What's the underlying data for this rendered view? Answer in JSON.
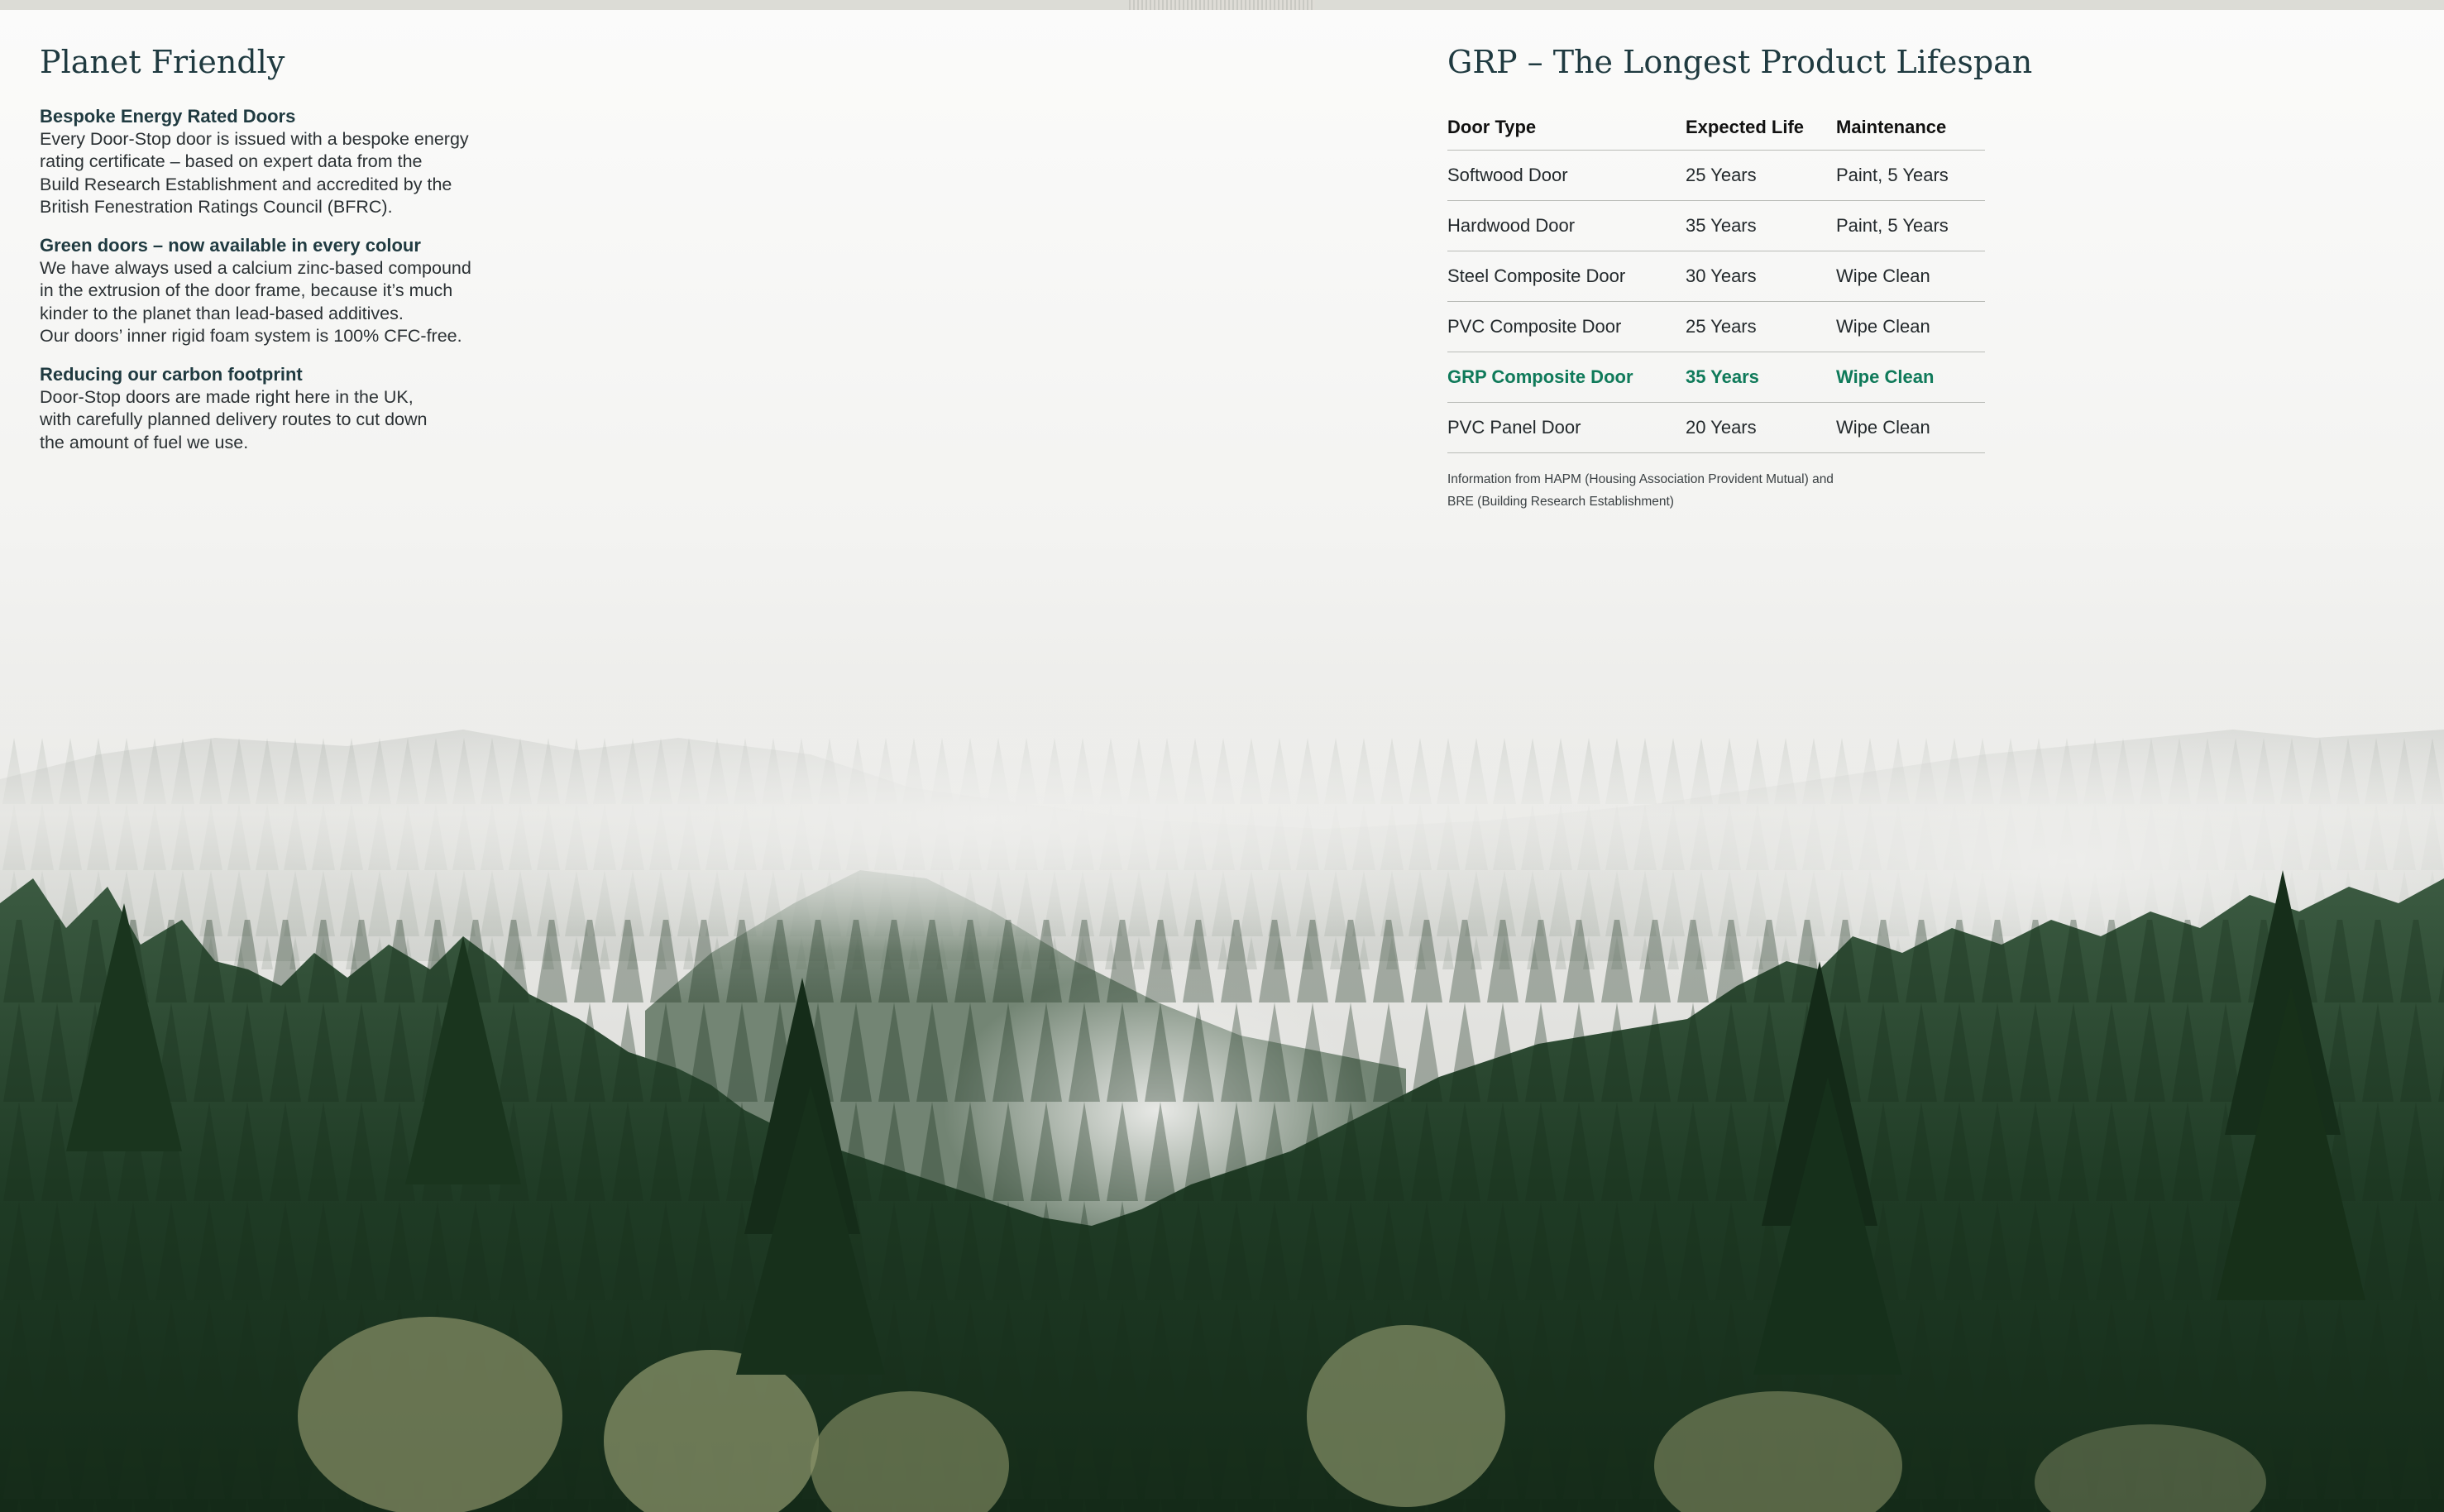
{
  "planet": {
    "title": "Planet Friendly",
    "sections": [
      {
        "heading": "Bespoke Energy Rated Doors",
        "body": "Every Door-Stop door is issued with a bespoke energy\nrating certificate – based on expert data from the\nBuild Research Establishment and accredited by the\nBritish Fenestration Ratings Council (BFRC)."
      },
      {
        "heading": "Green doors – now available in every colour",
        "body": "We have always used a calcium zinc-based compound\nin the extrusion of the door frame, because it’s much\nkinder to the planet than lead-based additives.\nOur doors’ inner rigid foam system is 100% CFC-free."
      },
      {
        "heading": "Reducing our carbon footprint",
        "body": "Door-Stop doors are made right here in the UK,\nwith carefully planned delivery routes to cut down\nthe amount of fuel we use."
      }
    ]
  },
  "lifespan": {
    "title": "GRP – The Longest Product Lifespan",
    "headers": [
      "Door Type",
      "Expected Life",
      "Maintenance"
    ],
    "rows": [
      [
        "Softwood Door",
        "25 Years",
        "Paint, 5 Years"
      ],
      [
        "Hardwood Door",
        "35 Years",
        "Paint, 5 Years"
      ],
      [
        "Steel Composite Door",
        "30 Years",
        "Wipe Clean"
      ],
      [
        "PVC Composite Door",
        "25 Years",
        "Wipe Clean"
      ],
      [
        "GRP Composite Door",
        "35 Years",
        "Wipe Clean"
      ],
      [
        "PVC Panel Door",
        "20 Years",
        "Wipe Clean"
      ]
    ],
    "highlight_row": "GRP Composite Door",
    "footnote": "Information from HAPM (Housing Association Provident Mutual) and\nBRE (Building Research Establishment)"
  },
  "colors": {
    "heading": "#1f3a40",
    "highlight": "#0f7a5a",
    "forest_dark": "#1d3a22",
    "mist": "#f3f3f1"
  }
}
